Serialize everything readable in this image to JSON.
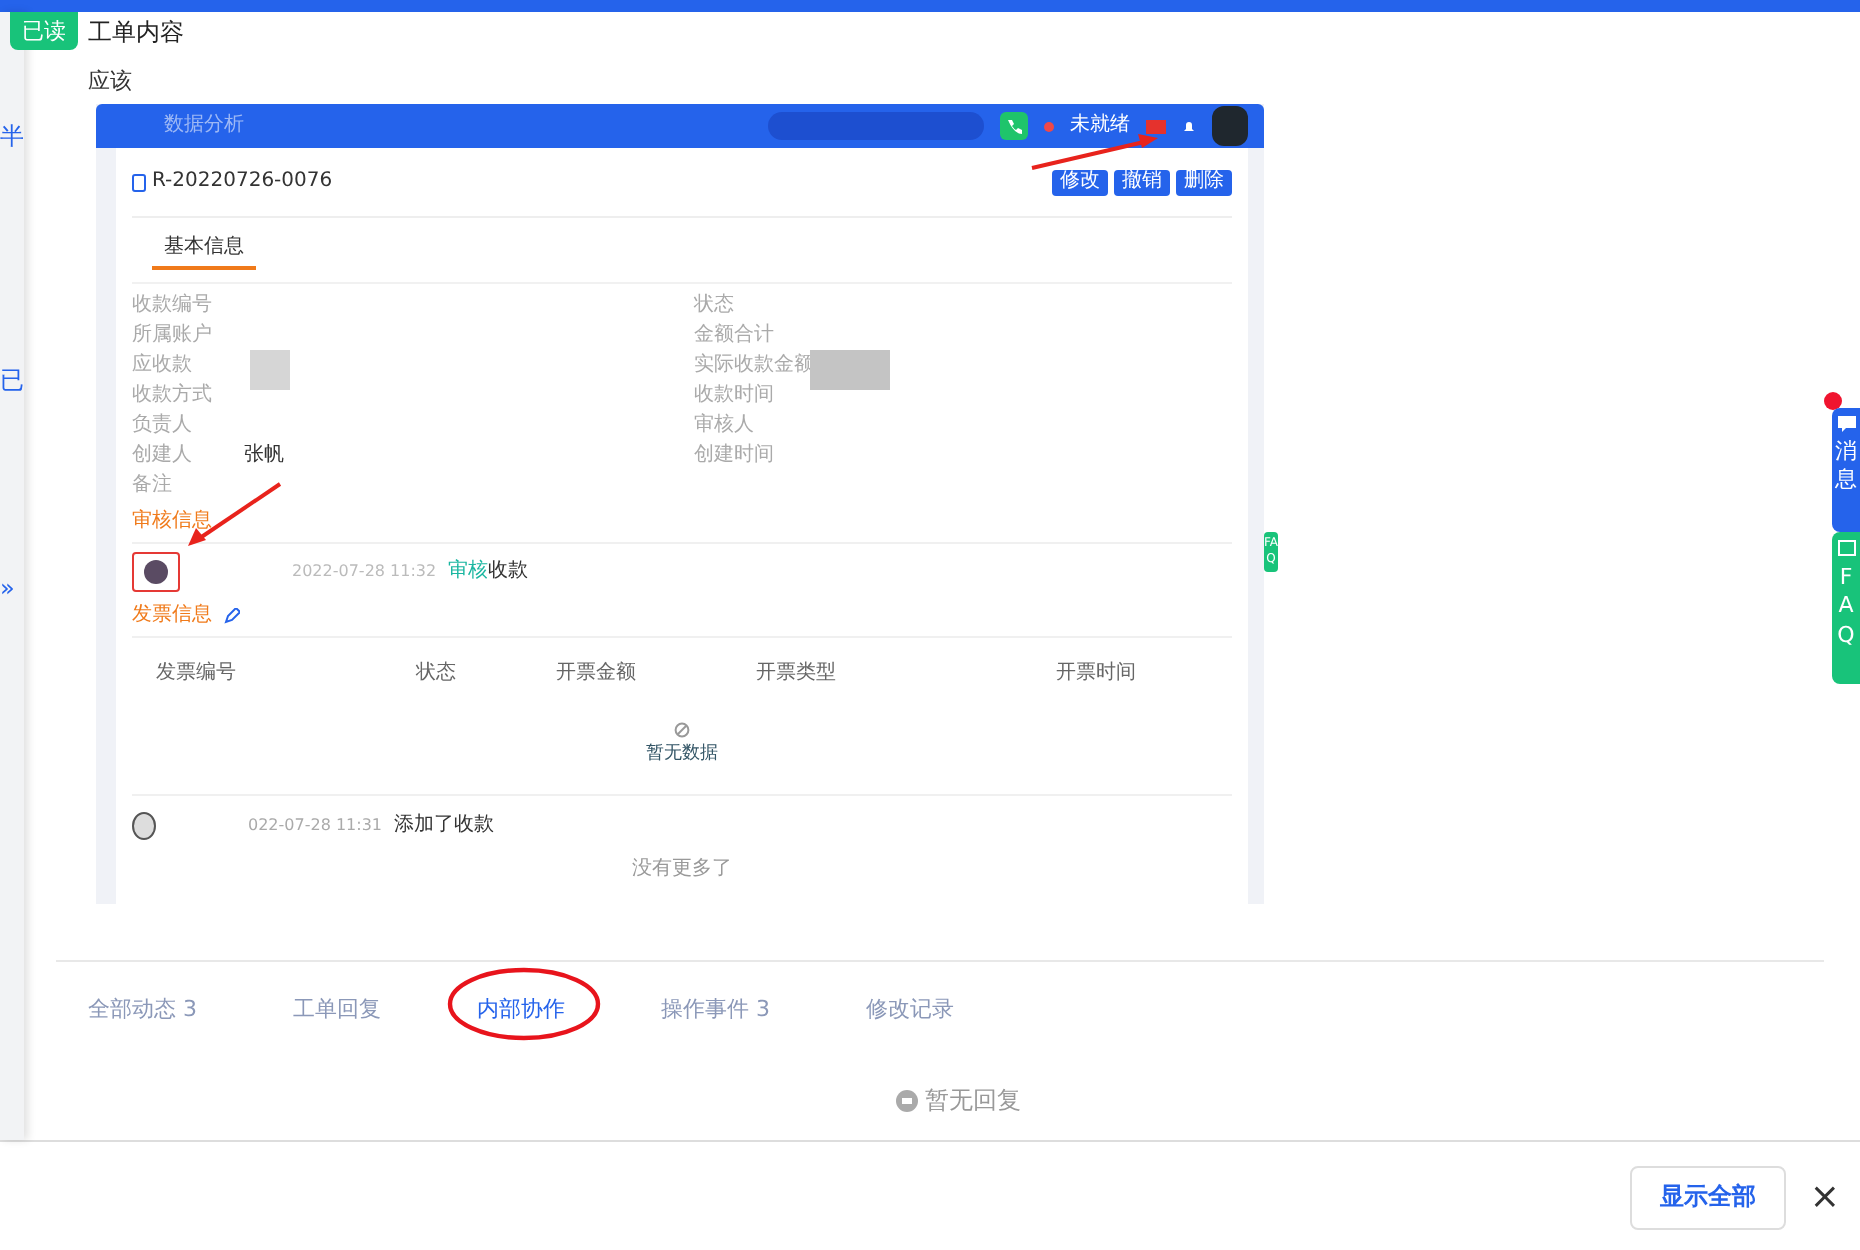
{
  "read_badge": "已读",
  "title": "工单内容",
  "body_text": "应该",
  "left_edge": [
    "半",
    "已",
    "»"
  ],
  "embedded_screenshot": {
    "topbar": {
      "nav_label": "数据分析",
      "status": "未就绪"
    },
    "record_id": "R-20220726-0076",
    "actions": [
      "修改",
      "撤销",
      "删除"
    ],
    "tabs": [
      {
        "label": "基本信息",
        "selected": true
      }
    ],
    "fields_left": [
      {
        "label": "收款编号"
      },
      {
        "label": "所属账户"
      },
      {
        "label": "应收款"
      },
      {
        "label": "收款方式"
      },
      {
        "label": "负责人"
      },
      {
        "label": "创建人",
        "value": "张帆"
      },
      {
        "label": "备注"
      }
    ],
    "fields_right": [
      {
        "label": "状态"
      },
      {
        "label": "金额合计"
      },
      {
        "label": "实际收款金额"
      },
      {
        "label": "收款时间"
      },
      {
        "label": "审核人"
      },
      {
        "label": "创建时间"
      }
    ],
    "review_section": "审核信息",
    "review_entry": {
      "time": "2022-07-28 11:32",
      "action": "审核",
      "object": "收款"
    },
    "invoice_section": "发票信息",
    "invoice_columns": [
      "发票编号",
      "状态",
      "开票金额",
      "开票类型",
      "开票时间"
    ],
    "empty_text": "暂无数据",
    "log_entry": {
      "time": "022-07-28 11:31",
      "text": "添加了收款"
    },
    "end_text": "没有更多了",
    "faq_tab": "FAQ"
  },
  "activity_tabs": [
    {
      "label": "全部动态 3",
      "selected": false
    },
    {
      "label": "工单回复",
      "selected": false
    },
    {
      "label": "内部协作",
      "selected": true
    },
    {
      "label": "操作事件 3",
      "selected": false
    },
    {
      "label": "修改记录",
      "selected": false
    }
  ],
  "empty_reply": "暂无回复",
  "show_all_button": "显示全部",
  "close": "×",
  "floating": {
    "messages": "消息",
    "messages_unread": true,
    "faq": "FAQ"
  }
}
